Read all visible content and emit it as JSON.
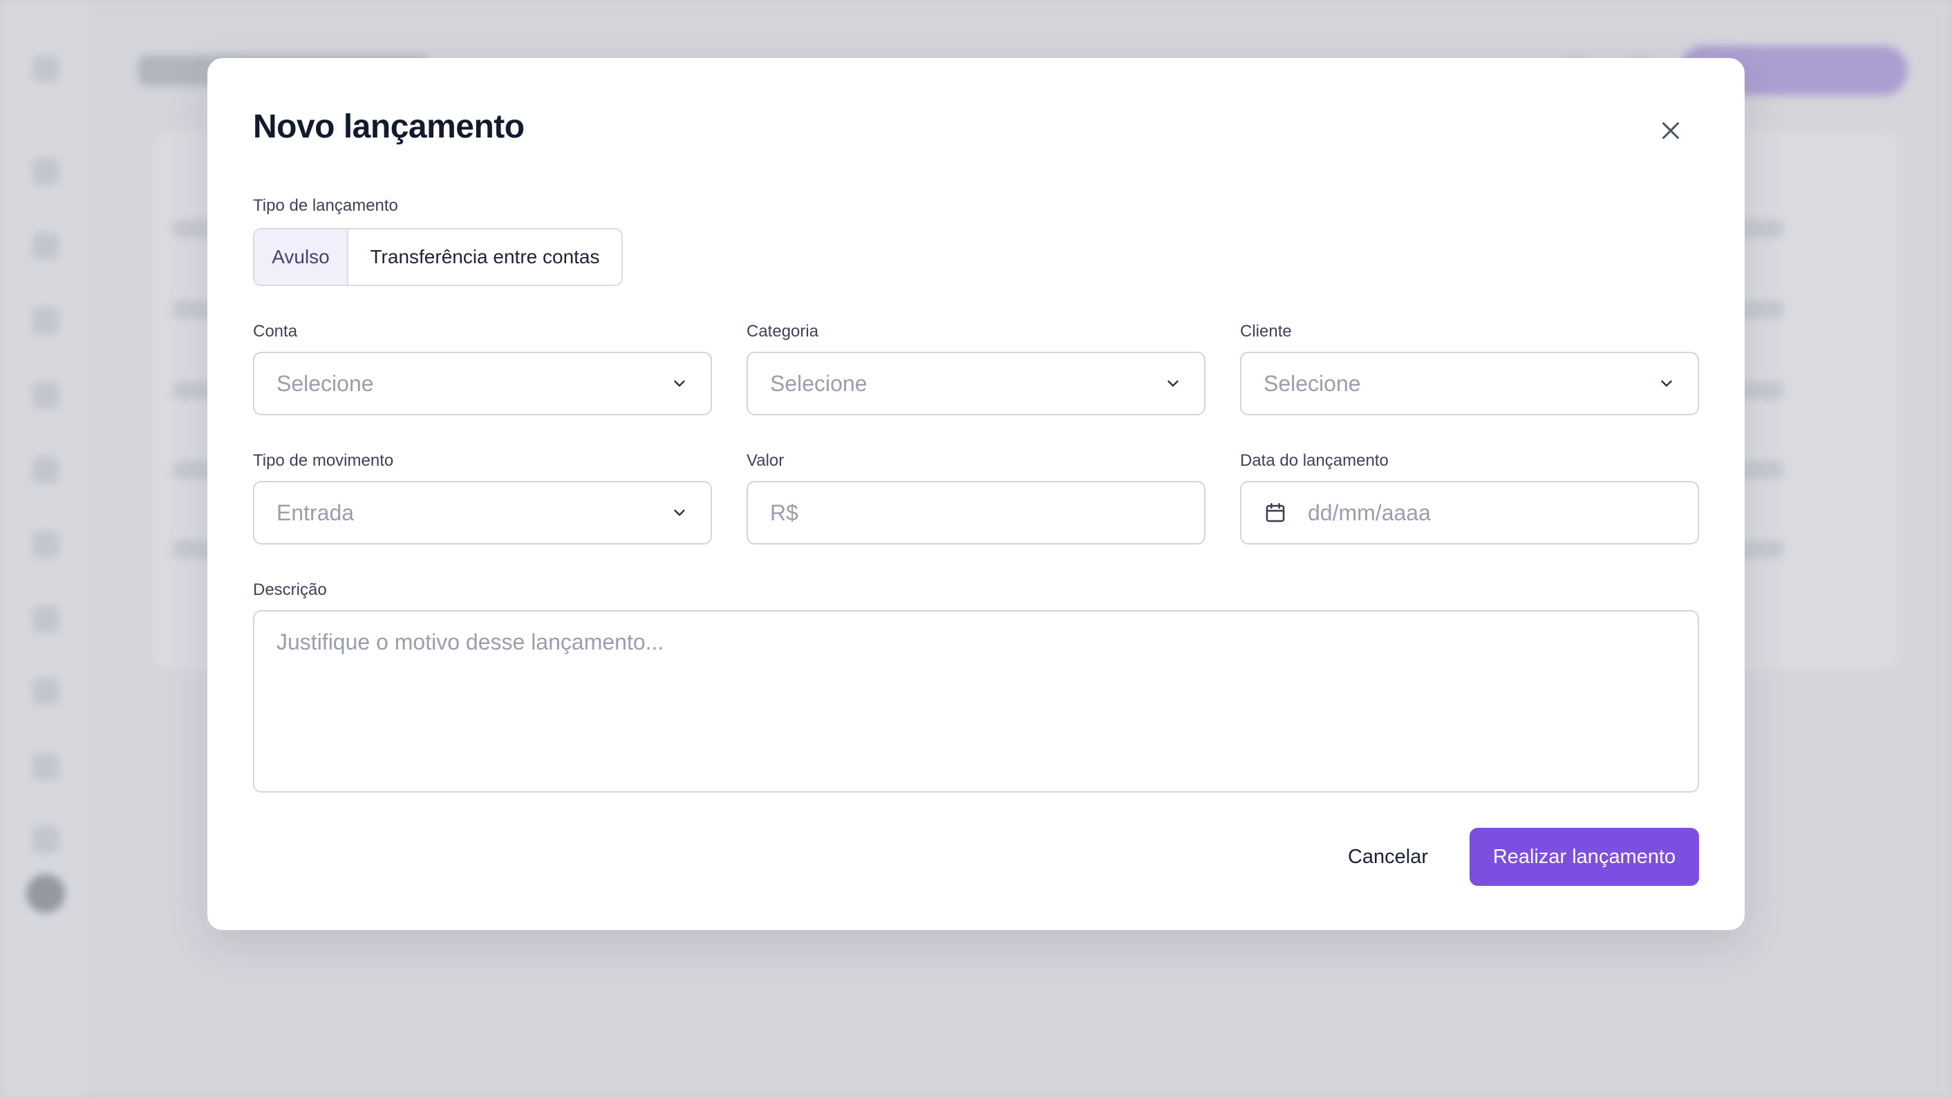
{
  "modal": {
    "title": "Novo lançamento",
    "tipo_lancamento": {
      "label": "Tipo de lançamento",
      "options": [
        "Avulso",
        "Transferência entre contas"
      ],
      "selected": "Avulso"
    },
    "conta": {
      "label": "Conta",
      "placeholder": "Selecione"
    },
    "categoria": {
      "label": "Categoria",
      "placeholder": "Selecione"
    },
    "cliente": {
      "label": "Cliente",
      "placeholder": "Selecione"
    },
    "tipo_movimento": {
      "label": "Tipo de movimento",
      "value": "Entrada"
    },
    "valor": {
      "label": "Valor",
      "placeholder": "R$"
    },
    "data": {
      "label": "Data do lançamento",
      "placeholder": "dd/mm/aaaa"
    },
    "descricao": {
      "label": "Descrição",
      "placeholder": "Justifique o motivo desse lançamento..."
    },
    "buttons": {
      "cancel": "Cancelar",
      "submit": "Realizar lançamento"
    }
  },
  "colors": {
    "accent": "#7c4fe0",
    "segment_active_bg": "#f1effa",
    "overlay": "#c4c6ce"
  },
  "icons": {
    "close": "close-icon",
    "chevron": "chevron-down-icon",
    "calendar": "calendar-icon"
  }
}
